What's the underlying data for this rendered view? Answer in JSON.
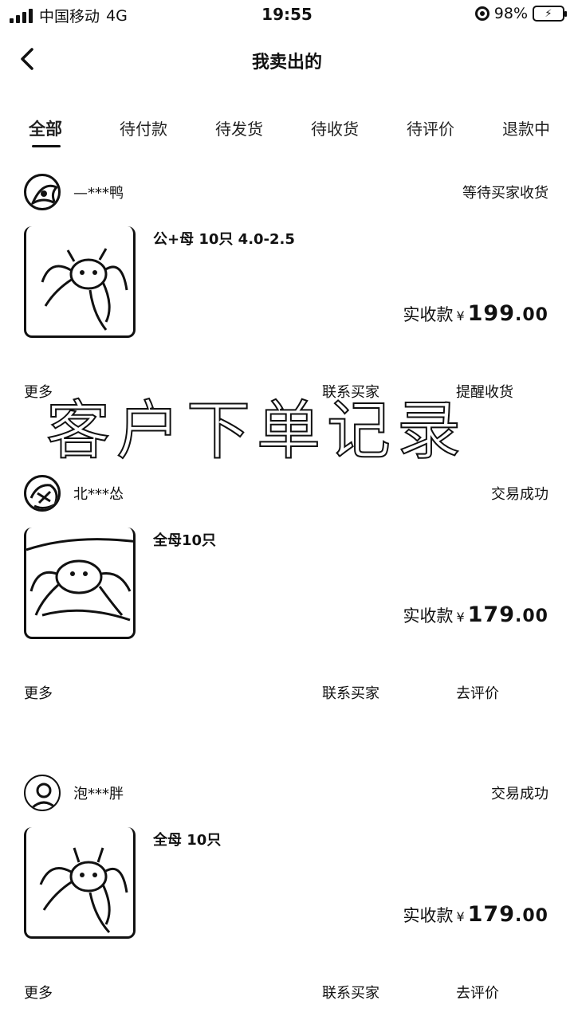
{
  "status_bar": {
    "carrier": "中国移动",
    "network": "4G",
    "time": "19:55",
    "battery": "98%"
  },
  "header": {
    "title": "我卖出的",
    "back_icon": "chevron-left-icon"
  },
  "tabs": [
    {
      "label": "全部",
      "active": true
    },
    {
      "label": "待付款",
      "active": false
    },
    {
      "label": "待发货",
      "active": false
    },
    {
      "label": "待收货",
      "active": false
    },
    {
      "label": "待评价",
      "active": false
    },
    {
      "label": "退款中",
      "active": false
    }
  ],
  "orders": [
    {
      "buyer": "—***鸭",
      "status": "等待买家收货",
      "product": "公+母  10只  4.0-2.5",
      "price_label": "实收款",
      "currency": "¥",
      "price_int": "199",
      "price_dec": ".00",
      "more": "更多",
      "contact": "联系买家",
      "action": "提醒收货"
    },
    {
      "buyer": "北***怂",
      "status": "交易成功",
      "product": "全母10只",
      "price_label": "实收款",
      "currency": "¥",
      "price_int": "179",
      "price_dec": ".00",
      "more": "更多",
      "contact": "联系买家",
      "action": "去评价"
    },
    {
      "buyer": "泡***胖",
      "status": "交易成功",
      "product": "全母 10只",
      "price_label": "实收款",
      "currency": "¥",
      "price_int": "179",
      "price_dec": ".00",
      "more": "更多",
      "contact": "联系买家",
      "action": "去评价"
    }
  ],
  "watermark": "客户下单记录"
}
